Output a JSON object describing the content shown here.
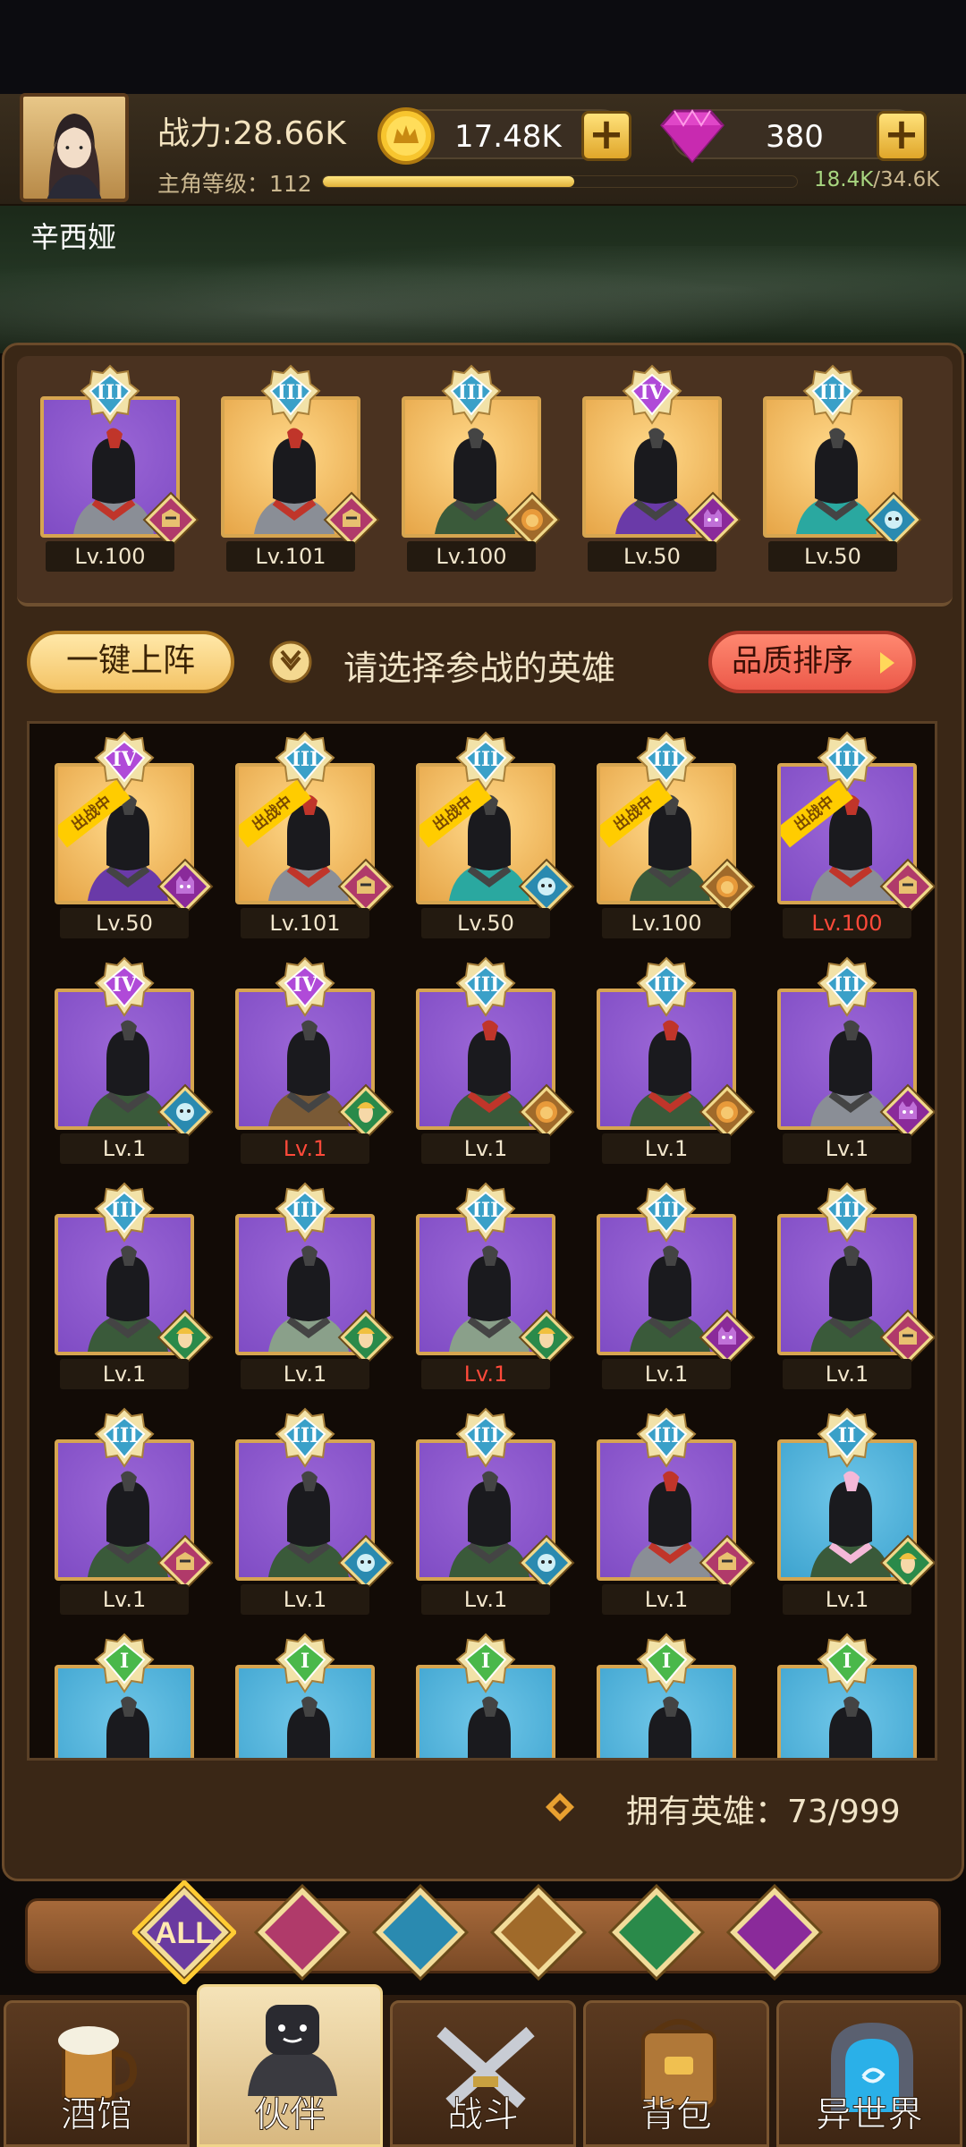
{
  "player": {
    "name": "辛西娅",
    "power": "战力:28.66K",
    "level_label": "主角等级：112",
    "level_current": "18.4K",
    "level_total": "/34.6K",
    "level_progress": 0.53
  },
  "resources": {
    "gold": "17.48K",
    "gems": "380"
  },
  "team": [
    {
      "rank": "III",
      "level": "Lv.100",
      "bg": "purple",
      "faction": "knight",
      "hero": "red-plume-knight",
      "level_red": false
    },
    {
      "rank": "III",
      "level": "Lv.101",
      "bg": "gold",
      "faction": "knight",
      "hero": "armored-knight",
      "level_red": false
    },
    {
      "rank": "III",
      "level": "Lv.100",
      "bg": "gold",
      "faction": "lion",
      "hero": "pharaoh",
      "level_red": false
    },
    {
      "rank": "IV",
      "level": "Lv.50",
      "bg": "gold",
      "faction": "demon",
      "hero": "purple-demon",
      "level_red": false
    },
    {
      "rank": "III",
      "level": "Lv.50",
      "bg": "gold",
      "faction": "fish",
      "hero": "teal-naga",
      "level_red": false
    }
  ],
  "controls": {
    "one_click_deploy": "一键上阵",
    "hint": "请选择参战的英雄",
    "sort": "品质排序"
  },
  "roster": [
    {
      "rank": "IV",
      "level": "Lv.50",
      "bg": "gold",
      "faction": "demon",
      "hero": "purple-demon",
      "deployed": true,
      "level_red": false
    },
    {
      "rank": "III",
      "level": "Lv.101",
      "bg": "gold",
      "faction": "knight",
      "hero": "armored-knight",
      "deployed": true,
      "level_red": false
    },
    {
      "rank": "III",
      "level": "Lv.50",
      "bg": "gold",
      "faction": "fish",
      "hero": "teal-naga",
      "deployed": true,
      "level_red": false
    },
    {
      "rank": "III",
      "level": "Lv.100",
      "bg": "gold",
      "faction": "lion",
      "hero": "pharaoh",
      "deployed": true,
      "level_red": false
    },
    {
      "rank": "III",
      "level": "Lv.100",
      "bg": "purple",
      "faction": "knight",
      "hero": "red-plume-knight",
      "deployed": true,
      "level_red": true
    },
    {
      "rank": "IV",
      "level": "Lv.1",
      "bg": "purple",
      "faction": "fish",
      "hero": "hooded-sage",
      "deployed": false,
      "level_red": false
    },
    {
      "rank": "IV",
      "level": "Lv.1",
      "bg": "purple",
      "faction": "elf",
      "hero": "treant",
      "deployed": false,
      "level_red": true
    },
    {
      "rank": "III",
      "level": "Lv.1",
      "bg": "purple",
      "faction": "lion",
      "hero": "horse-warrior",
      "deployed": false,
      "level_red": false
    },
    {
      "rank": "III",
      "level": "Lv.1",
      "bg": "purple",
      "faction": "lion",
      "hero": "horse-warrior",
      "deployed": false,
      "level_red": false
    },
    {
      "rank": "III",
      "level": "Lv.1",
      "bg": "purple",
      "faction": "demon",
      "hero": "headless-knight",
      "deployed": false,
      "level_red": false
    },
    {
      "rank": "III",
      "level": "Lv.1",
      "bg": "purple",
      "faction": "elf",
      "hero": "green-hood",
      "deployed": false,
      "level_red": false
    },
    {
      "rank": "III",
      "level": "Lv.1",
      "bg": "purple",
      "faction": "elf",
      "hero": "stone-golem",
      "deployed": false,
      "level_red": false
    },
    {
      "rank": "III",
      "level": "Lv.1",
      "bg": "purple",
      "faction": "elf",
      "hero": "stone-golem",
      "deployed": false,
      "level_red": true
    },
    {
      "rank": "III",
      "level": "Lv.1",
      "bg": "purple",
      "faction": "demon",
      "hero": "skull-reaper",
      "deployed": false,
      "level_red": false
    },
    {
      "rank": "III",
      "level": "Lv.1",
      "bg": "purple",
      "faction": "knight",
      "hero": "feather-hat-mage",
      "deployed": false,
      "level_red": false
    },
    {
      "rank": "III",
      "level": "Lv.1",
      "bg": "purple",
      "faction": "knight",
      "hero": "feather-hat-mage",
      "deployed": false,
      "level_red": false
    },
    {
      "rank": "III",
      "level": "Lv.1",
      "bg": "purple",
      "faction": "fish",
      "hero": "blue-elf",
      "deployed": false,
      "level_red": false
    },
    {
      "rank": "III",
      "level": "Lv.1",
      "bg": "purple",
      "faction": "fish",
      "hero": "blue-elf",
      "deployed": false,
      "level_red": false
    },
    {
      "rank": "III",
      "level": "Lv.1",
      "bg": "purple",
      "faction": "knight",
      "hero": "red-plume-knight",
      "deployed": false,
      "level_red": false
    },
    {
      "rank": "II",
      "level": "Lv.1",
      "bg": "blue",
      "faction": "elf",
      "hero": "flower-witch",
      "deployed": false,
      "level_red": false
    },
    {
      "rank": "I",
      "level": "",
      "bg": "blue",
      "faction": "knight",
      "hero": "dark-elf",
      "deployed": false,
      "level_red": false
    },
    {
      "rank": "I",
      "level": "",
      "bg": "blue",
      "faction": "knight",
      "hero": "dark-elf",
      "deployed": false,
      "level_red": false
    },
    {
      "rank": "I",
      "level": "",
      "bg": "blue",
      "faction": "knight",
      "hero": "green-hood",
      "deployed": false,
      "level_red": false
    },
    {
      "rank": "I",
      "level": "",
      "bg": "blue",
      "faction": "knight",
      "hero": "green-hood",
      "deployed": false,
      "level_red": false
    },
    {
      "rank": "I",
      "level": "",
      "bg": "blue",
      "faction": "knight",
      "hero": "wolf",
      "deployed": false,
      "level_red": false
    }
  ],
  "deployed_tag": "出战中",
  "owned_heroes": "拥有英雄：73/999",
  "filters": [
    {
      "name": "all",
      "label": "ALL",
      "color": "#6a3aa0",
      "active": true
    },
    {
      "name": "knight",
      "label": "",
      "color": "#b03a6a",
      "active": false
    },
    {
      "name": "fish",
      "label": "",
      "color": "#2a8ab0",
      "active": false
    },
    {
      "name": "lion",
      "label": "",
      "color": "#a06a2a",
      "active": false
    },
    {
      "name": "elf",
      "label": "",
      "color": "#2a8a4a",
      "active": false
    },
    {
      "name": "demon",
      "label": "",
      "color": "#8a2a9a",
      "active": false
    }
  ],
  "nav": [
    {
      "name": "tavern",
      "label": "酒馆",
      "active": false
    },
    {
      "name": "partner",
      "label": "伙伴",
      "active": true
    },
    {
      "name": "battle",
      "label": "战斗",
      "active": false
    },
    {
      "name": "backpack",
      "label": "背包",
      "active": false
    },
    {
      "name": "otherworld",
      "label": "异世界",
      "active": false
    }
  ],
  "colors": {
    "rank_blue": "#3aa0c8",
    "rank_purple": "#b04ad8",
    "rank_green": "#4ab84a",
    "level_red": "#ff4a3a",
    "deploy_yellow": "#ffcc00"
  }
}
